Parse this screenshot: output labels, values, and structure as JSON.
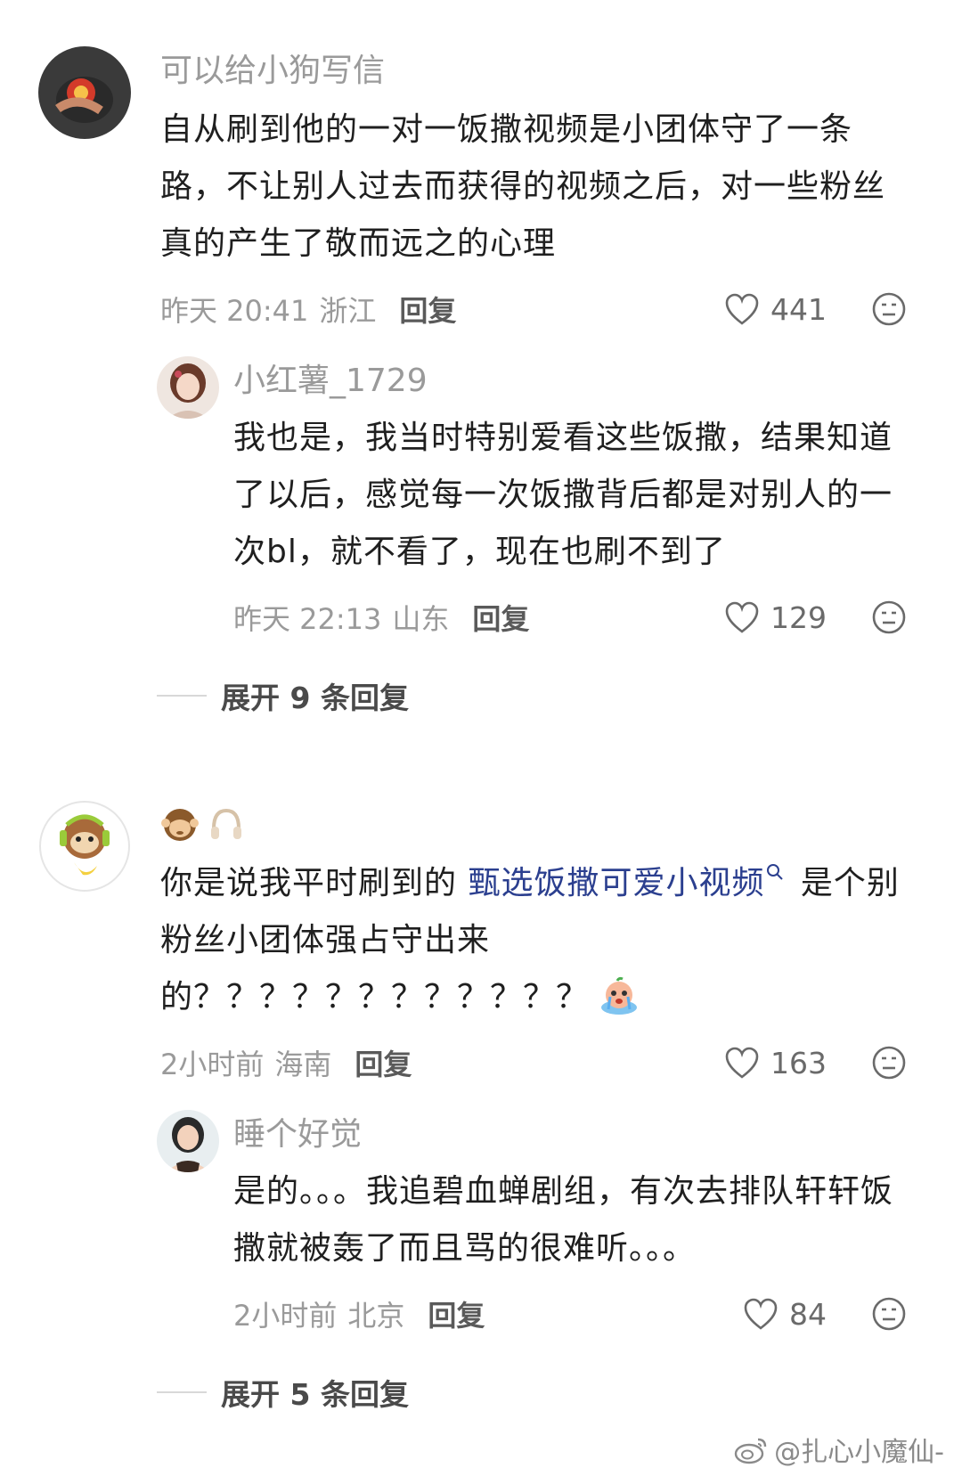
{
  "comments": [
    {
      "username": "可以给小狗写信",
      "text": "自从刷到他的一对一饭撒视频是小团体守了一条路，不让别人过去而获得的视频之后，对一些粉丝真的产生了敬而远之的心理",
      "time": "昨天 20:41",
      "location": "浙江",
      "reply_label": "回复",
      "likes": "441",
      "reply": {
        "username": "小红薯_1729",
        "text": "我也是，我当时特别爱看这些饭撒，结果知道了以后，感觉每一次饭撒背后都是对别人的一次bl，就不看了，现在也刷不到了",
        "time": "昨天 22:13",
        "location": "山东",
        "reply_label": "回复",
        "likes": "129"
      },
      "expand_label": "展开 9 条回复"
    },
    {
      "username_icons": [
        "monkey-emoji-icon",
        "headphones-icon"
      ],
      "text_before": "你是说我平时刷到的 ",
      "link_text": "甄选饭撒可爱小视频",
      "text_after": " 是个别粉丝小团体强占守出来的？？？？？？？？？？？？",
      "time": "2小时前",
      "location": "海南",
      "reply_label": "回复",
      "likes": "163",
      "reply": {
        "username": "睡个好觉",
        "text": "是的。。。我追碧血蝉剧组，有次去排队轩轩饭撒就被轰了而且骂的很难听。。。",
        "time": "2小时前",
        "location": "北京",
        "reply_label": "回复",
        "likes": "84"
      },
      "expand_label": "展开 5 条回复"
    }
  ],
  "watermark": "@扎心小魔仙-",
  "colors": {
    "username": "#9a9a9a",
    "text": "#1f1f1f",
    "link": "#2b3f8f",
    "meta": "#9a9a9a"
  }
}
